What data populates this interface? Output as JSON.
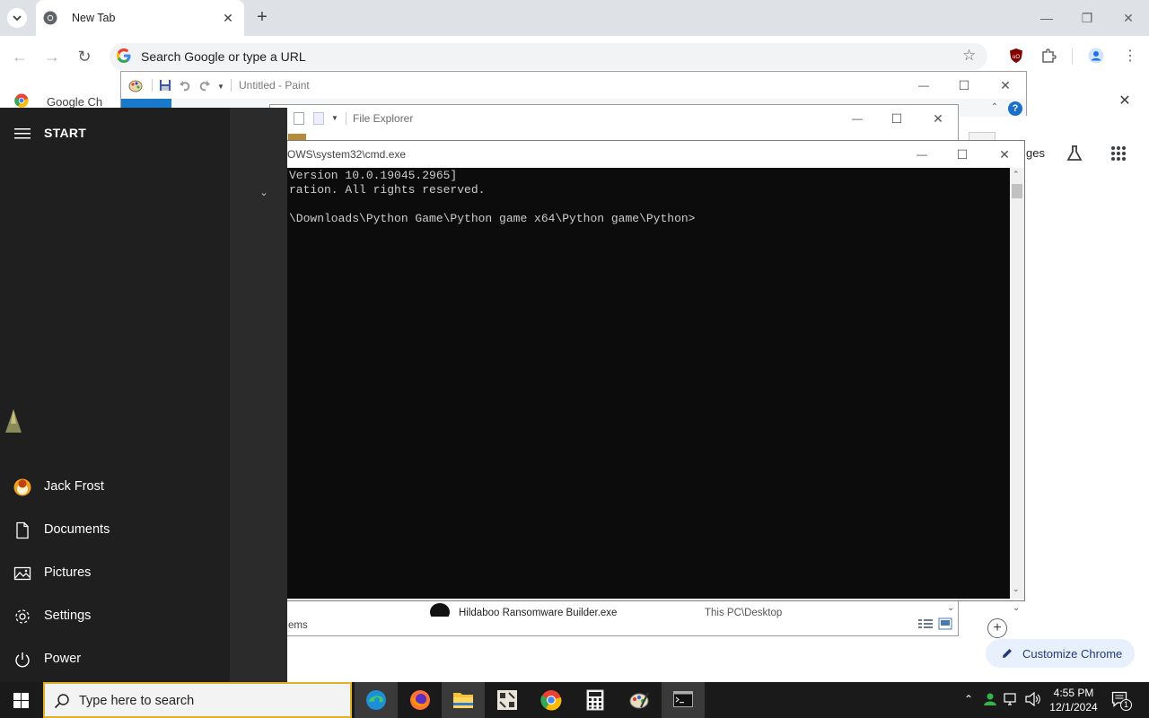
{
  "chrome": {
    "tab_title": "New Tab",
    "omnibox_placeholder": "Search Google or type a URL",
    "bookmark_label": "Google Ch",
    "partial_text": "ges",
    "customize_label": "Customize Chrome"
  },
  "paint": {
    "title": "Untitled - Paint"
  },
  "file_explorer": {
    "title": "File Explorer",
    "file_name": "Hildaboo Ransomware Builder.exe",
    "file_location": "This PC\\Desktop",
    "status": "ems"
  },
  "cmd": {
    "title": "OWS\\system32\\cmd.exe",
    "lines": [
      "Version 10.0.19045.2965]",
      "ration. All rights reserved.",
      "",
      "\\Downloads\\Python Game\\Python game x64\\Python game\\Python>"
    ]
  },
  "start_menu": {
    "header": "START",
    "items": [
      {
        "label": "Jack Frost",
        "icon": "user-avatar-icon"
      },
      {
        "label": "Documents",
        "icon": "document-icon"
      },
      {
        "label": "Pictures",
        "icon": "pictures-icon"
      },
      {
        "label": "Settings",
        "icon": "gear-icon"
      },
      {
        "label": "Power",
        "icon": "power-icon"
      }
    ]
  },
  "taskbar": {
    "search_placeholder": "Type here to search",
    "apps": [
      "edge-icon",
      "firefox-icon",
      "file-explorer-icon",
      "game-icon",
      "chrome-icon",
      "calculator-icon",
      "paint-icon",
      "cmd-icon"
    ],
    "time": "4:55 PM",
    "date": "12/1/2024",
    "notification_count": "1"
  },
  "colors": {
    "accent": "#1a73e8",
    "taskbar": "#1a1a1a",
    "start": "#1f1f1f",
    "cmd_bg": "#0c0c0c"
  }
}
